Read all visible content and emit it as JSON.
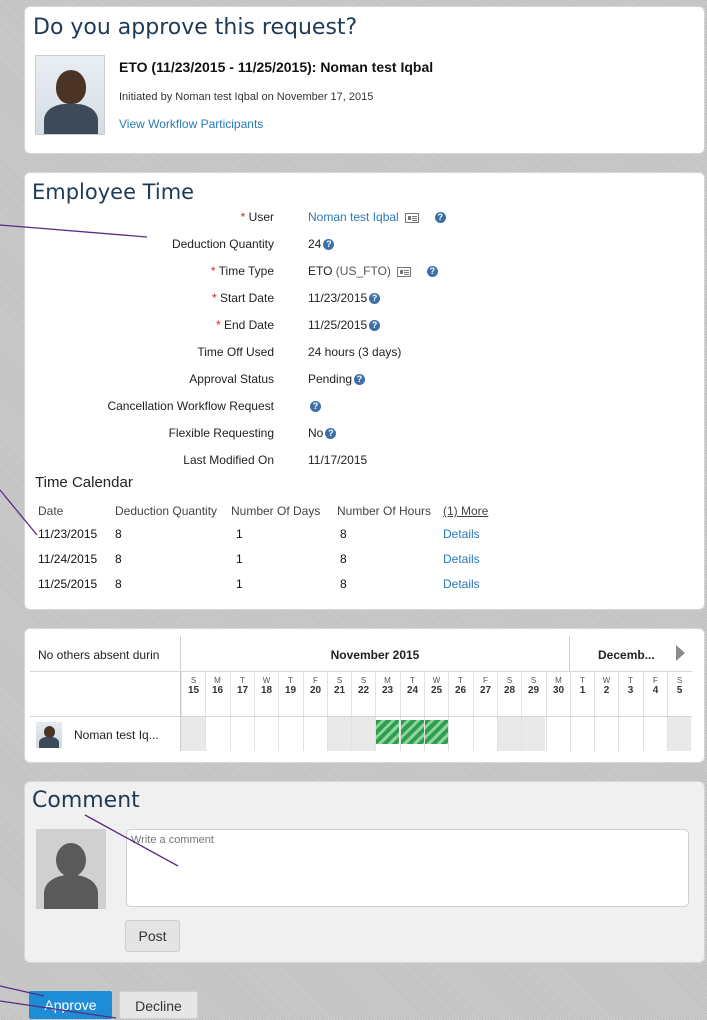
{
  "request": {
    "question": "Do you approve this request?",
    "title": "ETO (11/23/2015 - 11/25/2015): Noman test Iqbal",
    "initiated": "Initiated by Noman test Iqbal on November 17, 2015",
    "participants_link": "View Workflow Participants"
  },
  "employee_time": {
    "heading": "Employee Time",
    "fields": [
      {
        "label": "User",
        "required": true,
        "value": "Noman test Iqbal",
        "link": true,
        "card_icon": true,
        "help": true
      },
      {
        "label": "Deduction Quantity",
        "required": false,
        "value": "24",
        "help": true
      },
      {
        "label": "Time Type",
        "required": true,
        "value": "ETO",
        "value_suffix": "(US_FTO)",
        "card_icon": true,
        "help": true
      },
      {
        "label": "Start Date",
        "required": true,
        "value": "11/23/2015",
        "help": true
      },
      {
        "label": "End Date",
        "required": true,
        "value": "11/25/2015",
        "help": true
      },
      {
        "label": "Time Off Used",
        "required": false,
        "value": "24 hours (3 days)",
        "help": false
      },
      {
        "label": "Approval Status",
        "required": false,
        "value": "Pending",
        "help": true
      },
      {
        "label": "Cancellation Workflow Request",
        "required": false,
        "value": "",
        "help": true
      },
      {
        "label": "Flexible Requesting",
        "required": false,
        "value": "No",
        "help": true
      },
      {
        "label": "Last Modified On",
        "required": false,
        "value": "11/17/2015",
        "help": false
      }
    ],
    "required_mark": "*"
  },
  "time_calendar": {
    "heading": "Time Calendar",
    "columns": [
      "Date",
      "Deduction Quantity",
      "Number Of Days",
      "Number Of Hours"
    ],
    "more_link": "(1) More",
    "rows": [
      {
        "date": "11/23/2015",
        "qty": "8",
        "days": "1",
        "hours": "8",
        "details": "Details"
      },
      {
        "date": "11/24/2015",
        "qty": "8",
        "days": "1",
        "hours": "8",
        "details": "Details"
      },
      {
        "date": "11/25/2015",
        "qty": "8",
        "days": "1",
        "hours": "8",
        "details": "Details"
      }
    ]
  },
  "absence_calendar": {
    "title": "No others absent durin",
    "month1": "November 2015",
    "month2": "Decemb...",
    "days": [
      {
        "wd": "S",
        "d": "15"
      },
      {
        "wd": "M",
        "d": "16"
      },
      {
        "wd": "T",
        "d": "17"
      },
      {
        "wd": "W",
        "d": "18"
      },
      {
        "wd": "T",
        "d": "19"
      },
      {
        "wd": "F",
        "d": "20"
      },
      {
        "wd": "S",
        "d": "21"
      },
      {
        "wd": "S",
        "d": "22"
      },
      {
        "wd": "M",
        "d": "23"
      },
      {
        "wd": "T",
        "d": "24"
      },
      {
        "wd": "W",
        "d": "25"
      },
      {
        "wd": "T",
        "d": "26"
      },
      {
        "wd": "F",
        "d": "27"
      },
      {
        "wd": "S",
        "d": "28"
      },
      {
        "wd": "S",
        "d": "29"
      },
      {
        "wd": "M",
        "d": "30"
      },
      {
        "wd": "T",
        "d": "1"
      },
      {
        "wd": "W",
        "d": "2"
      },
      {
        "wd": "T",
        "d": "3"
      },
      {
        "wd": "F",
        "d": "4"
      },
      {
        "wd": "S",
        "d": "5"
      }
    ],
    "employee": "Noman test Iq...",
    "absent_dates": [
      "23",
      "24",
      "25"
    ],
    "absent_color": "#2e9e4e"
  },
  "comment": {
    "heading": "Comment",
    "placeholder": "Write a comment",
    "post_label": "Post"
  },
  "actions": {
    "approve_label": "Approve",
    "decline_label": "Decline",
    "approve_color": "#1f8dd6"
  }
}
